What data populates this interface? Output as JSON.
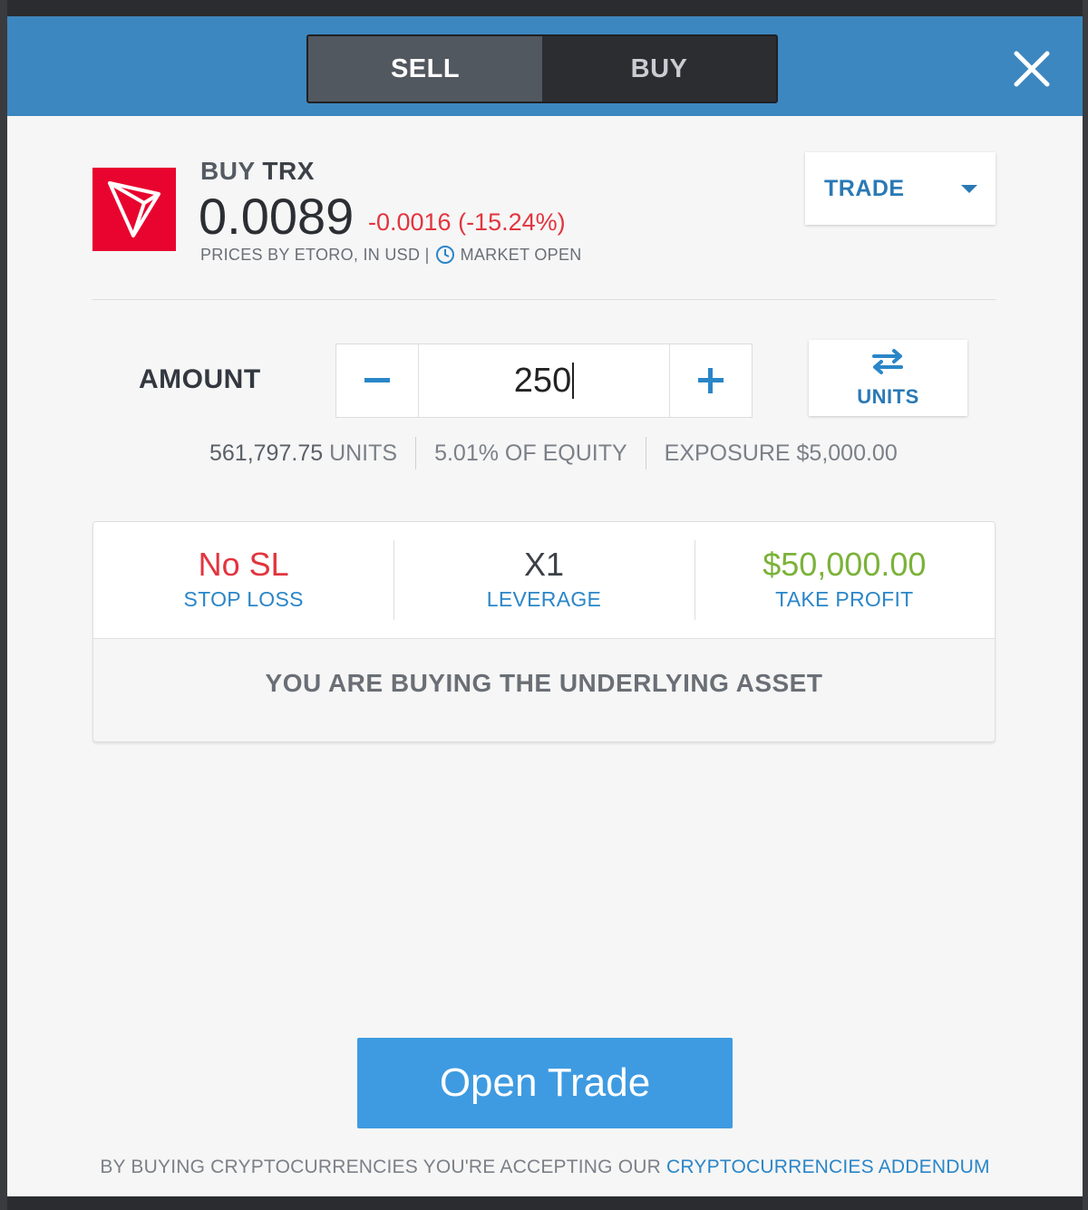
{
  "header": {
    "toggle": {
      "sell_label": "SELL",
      "buy_label": "BUY",
      "selected": "SELL"
    },
    "close_icon": "close-icon"
  },
  "asset": {
    "action": "BUY",
    "symbol": "TRX",
    "price": "0.0089",
    "change": "-0.0016 (-15.24%)",
    "prices_by": "PRICES BY ETORO, IN USD |",
    "market_status": "MARKET OPEN",
    "logo_icon": "tron-logo",
    "logo_color": "#e8042e"
  },
  "trade_dropdown": {
    "label": "TRADE"
  },
  "amount": {
    "label": "AMOUNT",
    "value": "250",
    "units_button_label": "UNITS"
  },
  "metrics": {
    "units_value": "561,797.75",
    "units_label": "UNITS",
    "equity": "5.01% OF EQUITY",
    "exposure": "EXPOSURE $5,000.00"
  },
  "settings": {
    "stop_loss": {
      "value": "No SL",
      "label": "STOP LOSS"
    },
    "leverage": {
      "value": "X1",
      "label": "LEVERAGE"
    },
    "take_profit": {
      "value": "$50,000.00",
      "label": "TAKE PROFIT"
    },
    "note": "YOU ARE BUYING THE UNDERLYING ASSET"
  },
  "open_trade_label": "Open Trade",
  "footer": {
    "text": "BY BUYING CRYPTOCURRENCIES YOU'RE ACCEPTING OUR",
    "link": "CRYPTOCURRENCIES ADDENDUM"
  },
  "colors": {
    "header_bg": "#3d87c0",
    "accent_blue": "#2a79b5",
    "negative_red": "#e2353f",
    "positive_green": "#7bb23a",
    "button_blue": "#3e9be1"
  }
}
